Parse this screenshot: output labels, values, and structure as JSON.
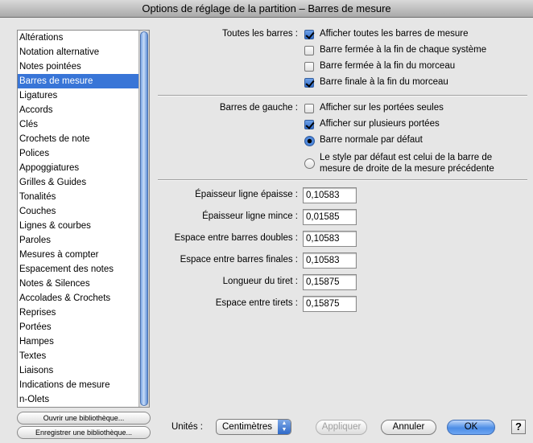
{
  "window": {
    "title": "Options de réglage de la partition – Barres de mesure"
  },
  "sidebar": {
    "items": [
      "Altérations",
      "Notation alternative",
      "Notes pointées",
      "Barres de mesure",
      "Ligatures",
      "Accords",
      "Clés",
      "Crochets de note",
      "Polices",
      "Appoggiatures",
      "Grilles & Guides",
      "Tonalités",
      "Couches",
      "Lignes & courbes",
      "Paroles",
      "Mesures à compter",
      "Espacement des notes",
      "Notes & Silences",
      "Accolades & Crochets",
      "Reprises",
      "Portées",
      "Hampes",
      "Textes",
      "Liaisons",
      "Indications de mesure",
      "n-Olets"
    ],
    "selected_index": 3,
    "open_library_label": "Ouvrir une bibliothèque...",
    "save_library_label": "Enregistrer une bibliothèque..."
  },
  "all_bars": {
    "label": "Toutes les barres :",
    "options": [
      {
        "label": "Afficher toutes les barres de mesure",
        "checked": true
      },
      {
        "label": "Barre fermée à la fin de chaque système",
        "checked": false
      },
      {
        "label": "Barre fermée à la fin du morceau",
        "checked": false
      },
      {
        "label": "Barre finale à la fin du morceau",
        "checked": true
      }
    ]
  },
  "left_bars": {
    "label": "Barres de gauche :",
    "checkboxes": [
      {
        "label": "Afficher sur les portées seules",
        "checked": false
      },
      {
        "label": "Afficher sur plusieurs portées",
        "checked": true
      }
    ],
    "radios": [
      {
        "label": "Barre normale par défaut",
        "checked": true
      },
      {
        "line1": "Le style par défaut est celui de la barre de",
        "line2": "mesure de droite de la mesure précédente",
        "checked": false
      }
    ]
  },
  "fields": [
    {
      "label": "Épaisseur ligne épaisse :",
      "value": "0,10583"
    },
    {
      "label": "Épaisseur ligne mince :",
      "value": "0,01585"
    },
    {
      "label": "Espace entre barres doubles :",
      "value": "0,10583"
    },
    {
      "label": "Espace entre barres finales :",
      "value": "0,10583"
    },
    {
      "label": "Longueur du tiret :",
      "value": "0,15875"
    },
    {
      "label": "Espace entre tirets :",
      "value": "0,15875"
    }
  ],
  "footer": {
    "units_label": "Unités :",
    "units_value": "Centimètres",
    "apply_label": "Appliquer",
    "cancel_label": "Annuler",
    "ok_label": "OK",
    "help_label": "?"
  }
}
